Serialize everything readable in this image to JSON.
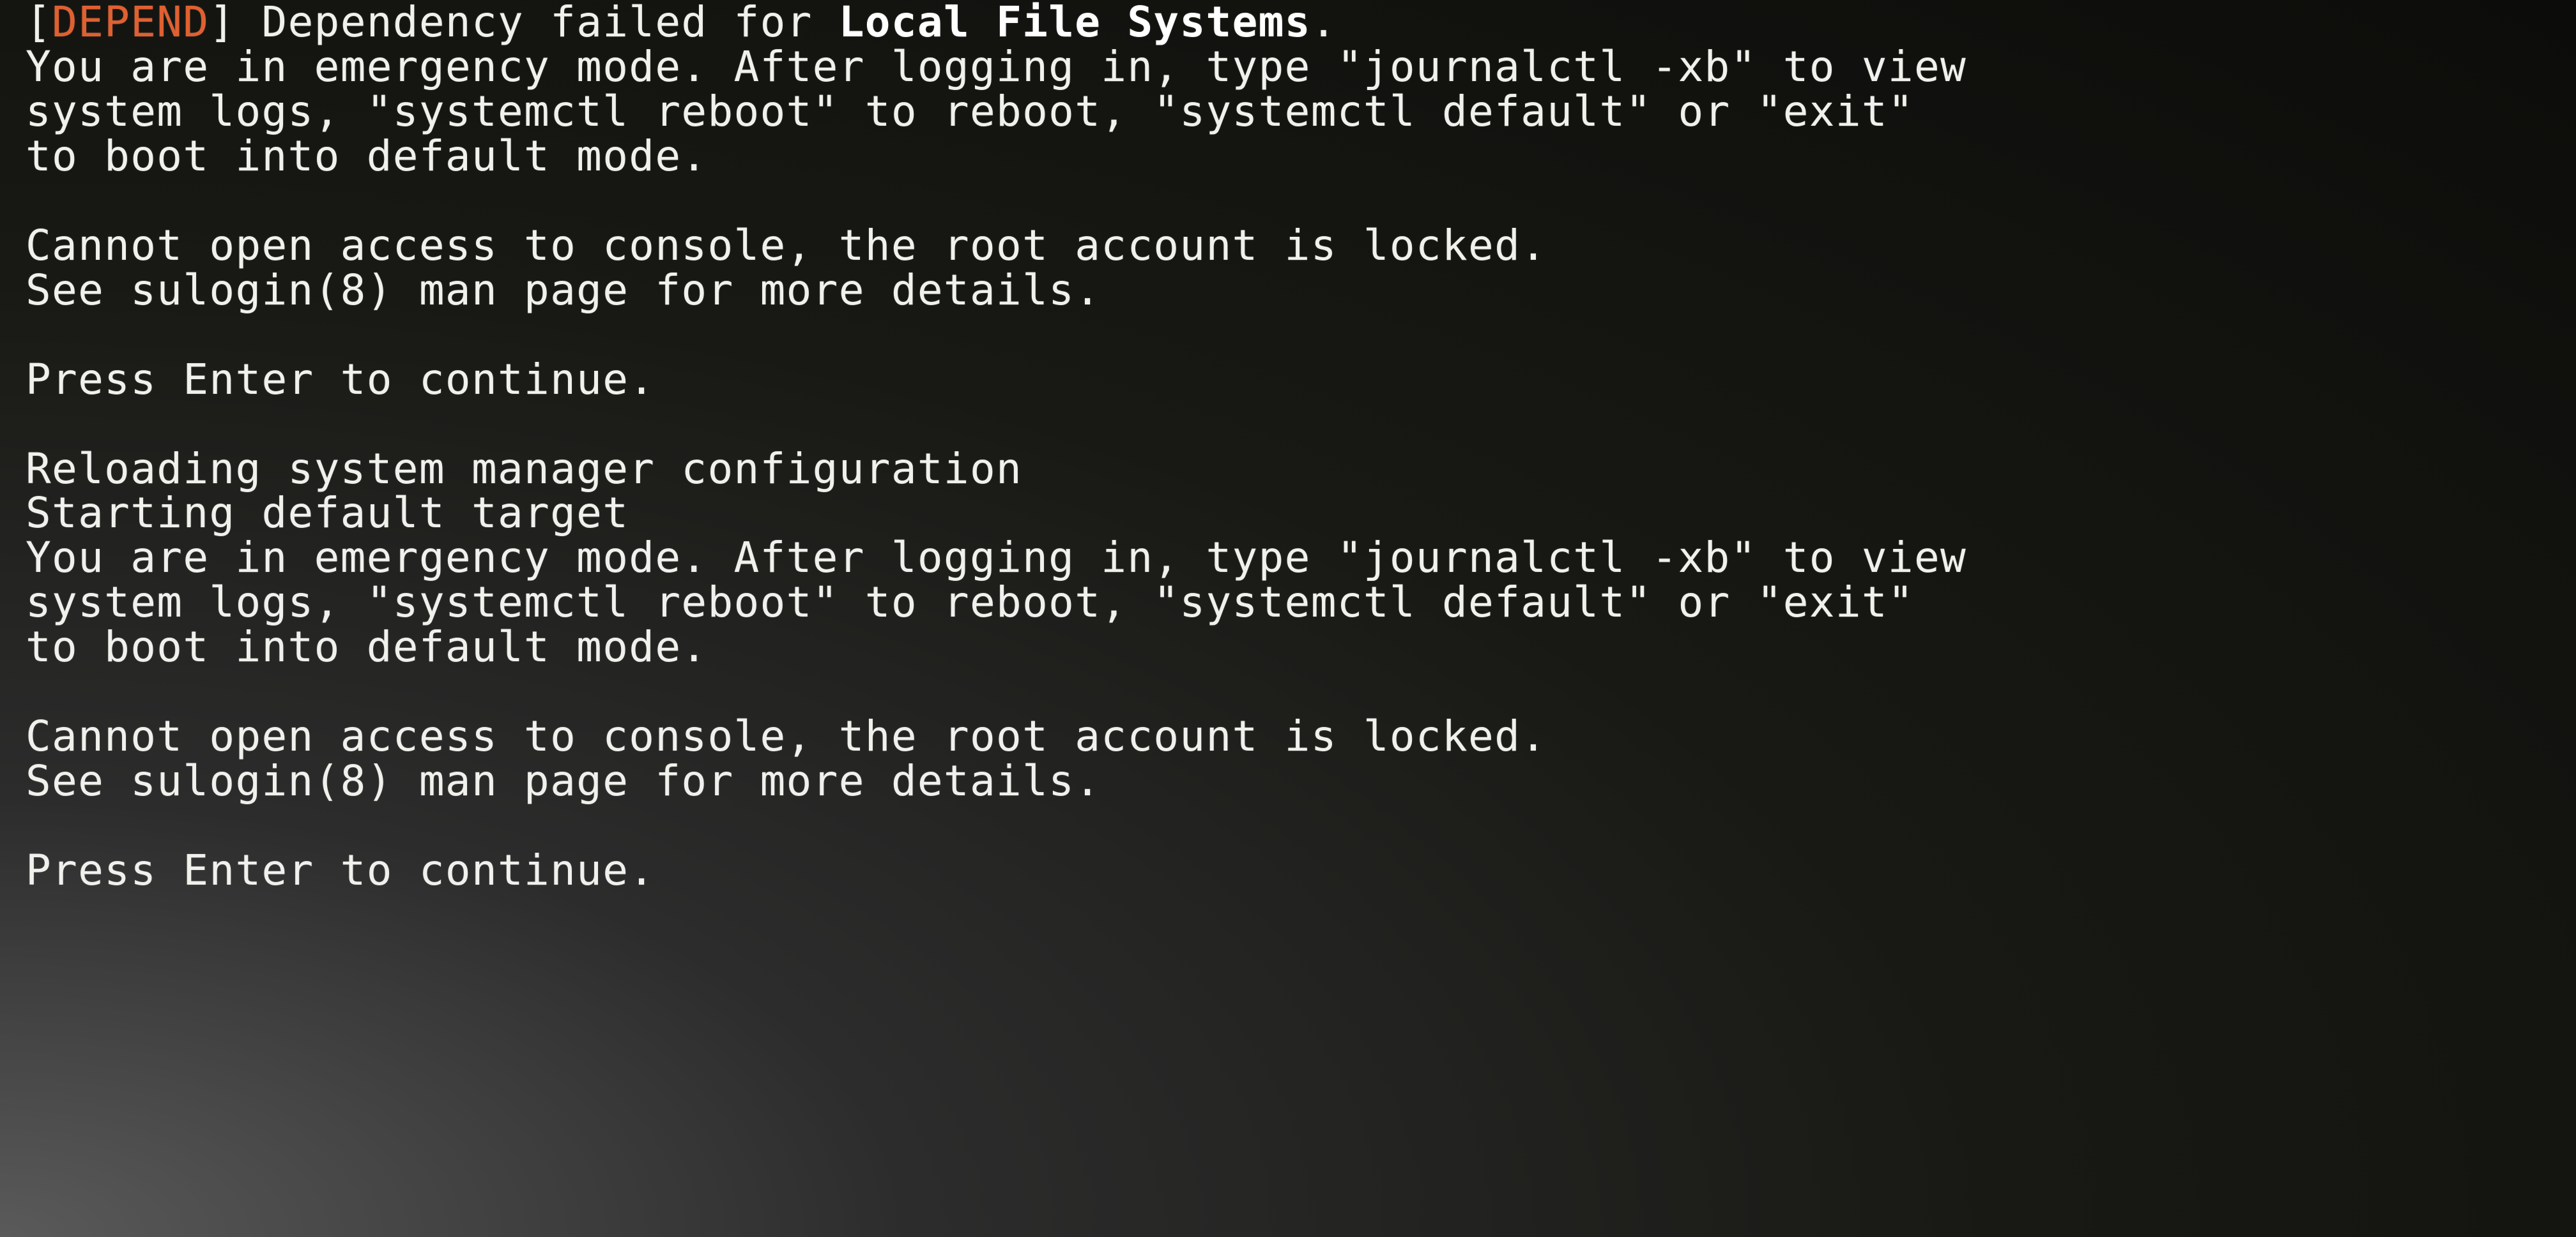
{
  "colors": {
    "foreground": "#f0f0ec",
    "depend_tag": "#e06030",
    "background_dark": "#0c0c0a"
  },
  "console": {
    "lines": [
      {
        "type": "depend",
        "open": "[",
        "tag": "DEPEND",
        "close": "] ",
        "pre": "Dependency failed for ",
        "bold": "Local File Systems",
        "post": "."
      },
      {
        "type": "plain",
        "text": "You are in emergency mode. After logging in, type \"journalctl -xb\" to view"
      },
      {
        "type": "plain",
        "text": "system logs, \"systemctl reboot\" to reboot, \"systemctl default\" or \"exit\""
      },
      {
        "type": "plain",
        "text": "to boot into default mode."
      },
      {
        "type": "blank"
      },
      {
        "type": "plain",
        "text": "Cannot open access to console, the root account is locked."
      },
      {
        "type": "plain",
        "text": "See sulogin(8) man page for more details."
      },
      {
        "type": "blank"
      },
      {
        "type": "plain",
        "text": "Press Enter to continue."
      },
      {
        "type": "blank"
      },
      {
        "type": "plain",
        "text": "Reloading system manager configuration"
      },
      {
        "type": "plain",
        "text": "Starting default target"
      },
      {
        "type": "plain",
        "text": "You are in emergency mode. After logging in, type \"journalctl -xb\" to view"
      },
      {
        "type": "plain",
        "text": "system logs, \"systemctl reboot\" to reboot, \"systemctl default\" or \"exit\""
      },
      {
        "type": "plain",
        "text": "to boot into default mode."
      },
      {
        "type": "blank"
      },
      {
        "type": "plain",
        "text": "Cannot open access to console, the root account is locked."
      },
      {
        "type": "plain",
        "text": "See sulogin(8) man page for more details."
      },
      {
        "type": "blank"
      },
      {
        "type": "plain",
        "text": "Press Enter to continue."
      }
    ]
  }
}
